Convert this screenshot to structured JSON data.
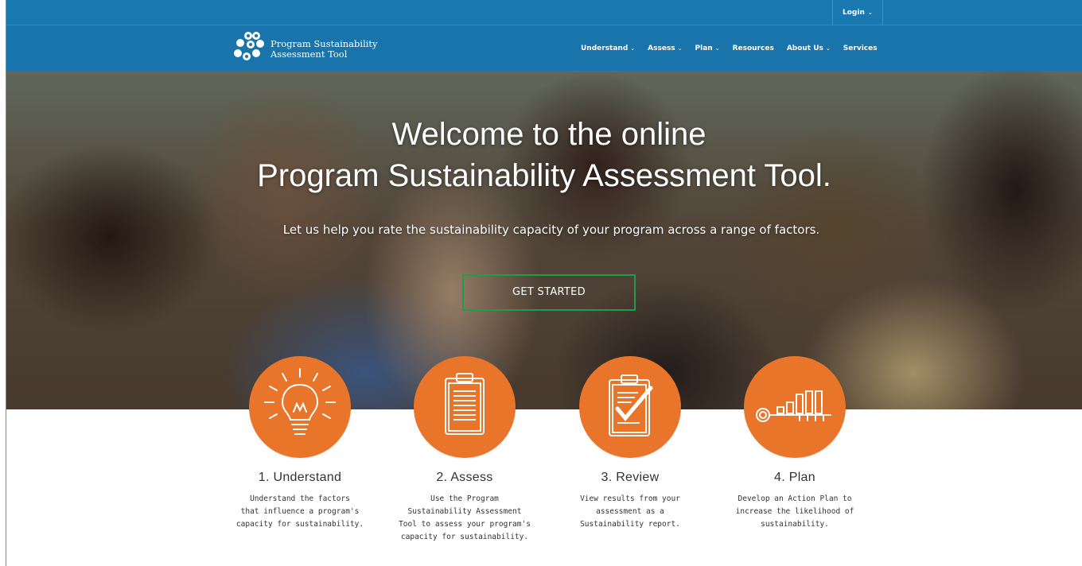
{
  "topbar": {
    "login_label": "Login"
  },
  "brand": {
    "line1": "Program Sustainability",
    "line2": "Assessment Tool"
  },
  "nav": {
    "understand": "Understand",
    "assess": "Assess",
    "plan": "Plan",
    "resources": "Resources",
    "about": "About Us",
    "services": "Services"
  },
  "hero": {
    "title_line1": "Welcome to the online",
    "title_line2": "Program Sustainability Assessment Tool.",
    "subtitle": "Let us help you rate the sustainability capacity of your program across a range of factors.",
    "cta_label": "GET STARTED"
  },
  "steps": [
    {
      "title": "1. Understand",
      "desc": [
        "Understand the factors",
        "that influence a program's",
        "capacity for sustainability."
      ],
      "icon": "lightbulb-icon"
    },
    {
      "title": "2. Assess",
      "desc": [
        "Use the Program",
        "Sustainability Assessment",
        "Tool to assess your program's",
        "capacity for sustainability."
      ],
      "icon": "clipboard-icon"
    },
    {
      "title": "3. Review",
      "desc": [
        "View results from your",
        "assessment as a",
        "Sustainability report."
      ],
      "icon": "clipboard-check-icon"
    },
    {
      "title": "4. Plan",
      "desc": [
        "Develop an Action Plan to",
        "increase the likelihood of",
        "sustainability."
      ],
      "icon": "key-chart-icon"
    }
  ],
  "colors": {
    "nav_blue": "#1874aa",
    "accent_orange": "#e8752a",
    "cta_border": "#1f9d4a"
  }
}
